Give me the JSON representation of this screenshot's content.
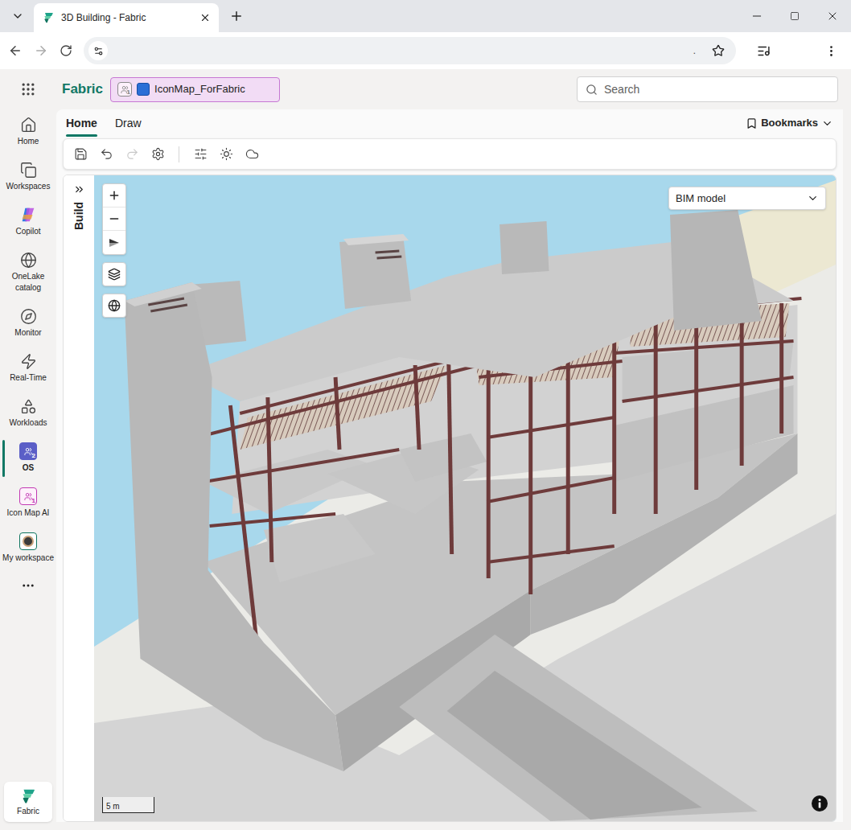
{
  "browser": {
    "tab": {
      "title": "3D Building - Fabric",
      "selected": true
    },
    "address": {
      "tail": "."
    }
  },
  "app": {
    "name": "Fabric",
    "workspace": {
      "name": "IconMap_ForFabric",
      "badge": "1"
    },
    "search": {
      "placeholder": "Search"
    }
  },
  "nav": {
    "items": [
      {
        "label": "Home",
        "kind": "icon",
        "selected": false
      },
      {
        "label": "Workspaces",
        "kind": "icon",
        "selected": false
      },
      {
        "label": "Copilot",
        "kind": "copilot",
        "selected": false
      },
      {
        "label": "OneLake catalog",
        "kind": "icon",
        "selected": false
      },
      {
        "label": "Monitor",
        "kind": "icon",
        "selected": false
      },
      {
        "label": "Real-Time",
        "kind": "icon",
        "selected": false
      },
      {
        "label": "Workloads",
        "kind": "icon",
        "selected": false
      },
      {
        "label": "OS",
        "kind": "tile",
        "badge": "2",
        "color": "#5b5fc7",
        "filled": true,
        "selected": true
      },
      {
        "label": "Icon Map AI",
        "kind": "tile",
        "badge": "1",
        "color": "#c239b3",
        "filled": false,
        "selected": false
      },
      {
        "label": "My workspace",
        "kind": "avatar",
        "selected": false
      }
    ],
    "footer": {
      "label": "Fabric"
    }
  },
  "ribbon": {
    "tabs": [
      {
        "label": "Home",
        "selected": true
      },
      {
        "label": "Draw",
        "selected": false
      }
    ],
    "bookmarks": "Bookmarks",
    "tools": [
      {
        "kind": "save",
        "disabled": false
      },
      {
        "kind": "undo",
        "disabled": false
      },
      {
        "kind": "redo",
        "disabled": true
      },
      {
        "kind": "settings",
        "disabled": false
      },
      {
        "kind": "separator"
      },
      {
        "kind": "filters",
        "disabled": false
      },
      {
        "kind": "light",
        "disabled": false
      },
      {
        "kind": "weather",
        "disabled": false
      }
    ]
  },
  "build_panel": {
    "title": "Build",
    "expanded": false
  },
  "map": {
    "layer": "BIM model",
    "scale": "5 m"
  }
}
